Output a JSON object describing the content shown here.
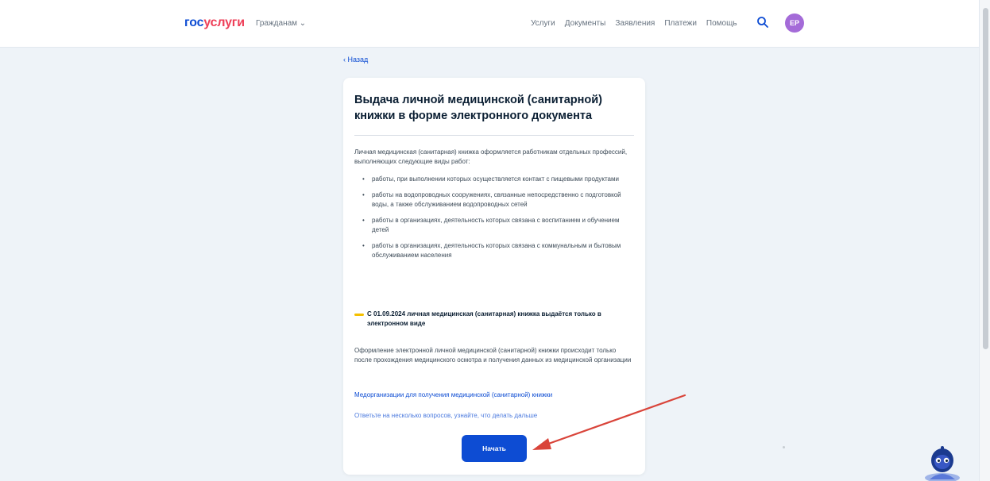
{
  "header": {
    "logo_part1": "гос",
    "logo_part2": "услуги",
    "role_selector": "Гражданам ⌄",
    "nav": [
      "Услуги",
      "Документы",
      "Заявления",
      "Платежи",
      "Помощь"
    ],
    "avatar_initials": "ЕР",
    "search_icon": "search-icon"
  },
  "back_link": "‹ Назад",
  "card": {
    "title": "Выдача личной медицинской (санитарной) книжки в форме электронного документа",
    "intro": "Личная медицинская (санитарная) книжка оформляется работникам отдельных профессий, выполняющих следующие виды работ:",
    "bullets": [
      "работы, при выполнении которых осуществляется контакт с пищевыми продуктами",
      "работы на водопроводных сооружениях, связанные непосредственно с подготовкой воды, а также обслуживанием водопроводных сетей",
      "работы в организациях, деятельность которых связана с воспитанием и обучением детей",
      "работы в организациях, деятельность которых связана с коммунальным и бытовым обслуживанием населения"
    ],
    "notice": "С 01.09.2024 личная медицинская (санитарная) книжка выдаётся только в электронном виде",
    "paragraph": "Оформление электронной личной медицинской (санитарной) книжки происходит только после прохождения медицинского осмотра и получения данных из медицинской организации",
    "link1": "Медорганизации для получения медицинской (санитарной) книжки",
    "link2": "Ответьте на несколько вопросов, узнайте, что делать дальше",
    "start_button": "Начать"
  },
  "colors": {
    "brand_blue": "#0d4cd3",
    "brand_red": "#ee3f58",
    "avatar": "#a46bd8",
    "notice_accent": "#f5c000",
    "annotation_arrow": "#d9443a"
  }
}
